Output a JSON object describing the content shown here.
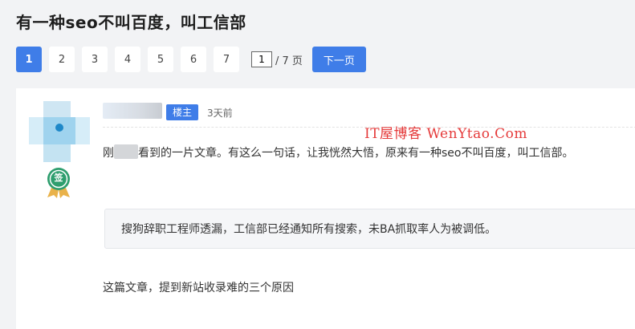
{
  "page": {
    "title": "有一种seo不叫百度，叫工信部"
  },
  "pagination": {
    "current": "1",
    "pages": [
      "1",
      "2",
      "3",
      "4",
      "5",
      "6",
      "7"
    ],
    "jump_value": "1",
    "total_label": "/ 7 页",
    "next_label": "下一页"
  },
  "post": {
    "owner_tag": "楼主",
    "time": "3天前",
    "watermark": "IT屋博客 WenYtao.Com",
    "paragraph1_prefix": "刚",
    "paragraph1_text": "看到的一片文章。有这么一句话，让我恍然大悟，原来有一种seo不叫百度，叫工信部。",
    "quote": "搜狗辞职工程师透漏，工信部已经通知所有搜索，未BA抓取率人为被调低。",
    "paragraph2": "这篇文章，提到新站收录难的三个原因",
    "badge_label": "签"
  },
  "colors": {
    "accent": "#3f7de8",
    "watermark": "#e53a3a",
    "badge_green": "#2e9e6e"
  }
}
